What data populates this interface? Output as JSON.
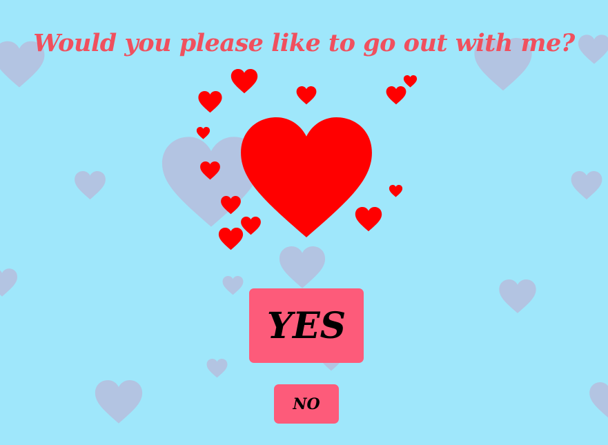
{
  "page": {
    "question": "Would you please like to go out with me?",
    "yes_label": "YES",
    "no_label": "NO"
  },
  "colors": {
    "background": "#9fe7fb",
    "title": "#f0505e",
    "button": "#fd5b7a",
    "button_text": "#000000",
    "heart_red": "#ff0000",
    "heart_faded": "#b3c4e2"
  },
  "icons": {
    "main": "heart-icon",
    "decorative": "heart-icon"
  }
}
